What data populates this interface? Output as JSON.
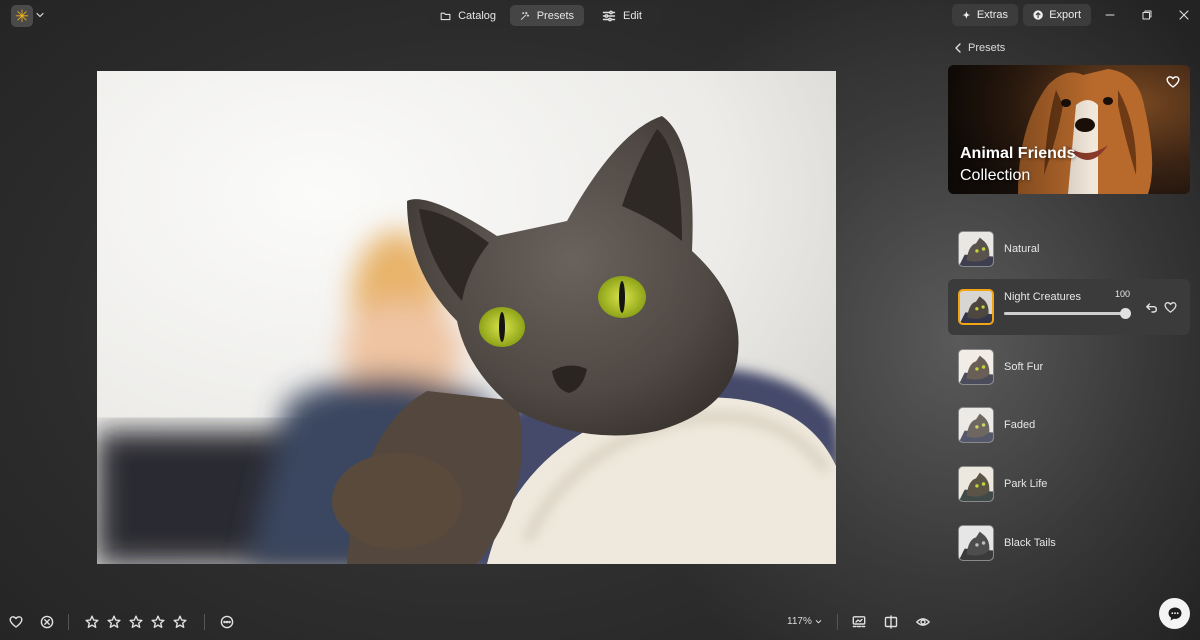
{
  "app": {
    "logo_icon": "sun-logo-icon",
    "accent_color": "#f2a413"
  },
  "modes": {
    "catalog_label": "Catalog",
    "presets_label": "Presets",
    "edit_label": "Edit",
    "active": "Presets"
  },
  "header_actions": {
    "extras_label": "Extras",
    "export_label": "Export"
  },
  "panel": {
    "back_label": "Presets",
    "collection": {
      "title": "Animal Friends",
      "subtitle": "Collection"
    },
    "presets": [
      {
        "label": "Natural"
      },
      {
        "label": "Night Creatures",
        "active": true,
        "intensity": "100",
        "intensity_fraction": 1.0
      },
      {
        "label": "Soft Fur"
      },
      {
        "label": "Faded"
      },
      {
        "label": "Park Life"
      },
      {
        "label": "Black Tails"
      }
    ]
  },
  "footer": {
    "rating_stars": 0,
    "rating_max": 5,
    "zoom_label": "117%"
  }
}
